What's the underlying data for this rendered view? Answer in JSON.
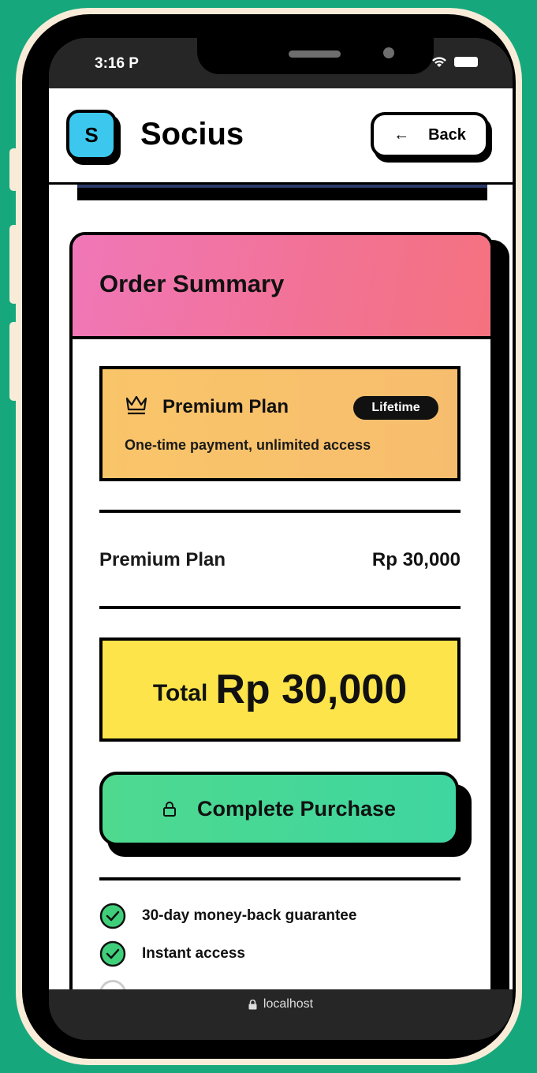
{
  "status_bar": {
    "time": "3:16 P"
  },
  "header": {
    "logo_letter": "S",
    "app_name": "Socius",
    "back_arrow": "←",
    "back_label": "Back"
  },
  "order": {
    "title": "Order Summary",
    "plan": {
      "name": "Premium Plan",
      "badge": "Lifetime",
      "description": "One-time payment, unlimited access"
    },
    "line_item": {
      "label": "Premium Plan",
      "price": "Rp 30,000"
    },
    "total": {
      "label": "Total",
      "amount": "Rp 30,000"
    },
    "purchase_button": "Complete Purchase",
    "benefits": [
      "30-day money-back guarantee",
      "Instant access"
    ]
  },
  "browser": {
    "url": "localhost"
  },
  "colors": {
    "background": "#16a87c",
    "logo": "#3cc8ee",
    "card_header": "#f27294",
    "plan_box": "#f9c569",
    "total_box": "#fce44a",
    "purchase_button": "#4ed98e",
    "check": "#3fcf7a"
  },
  "icons": {
    "back": "arrow-left-icon",
    "plan": "crown-icon",
    "purchase": "lock-icon",
    "benefit": "check-circle-icon",
    "url": "lock-icon"
  }
}
